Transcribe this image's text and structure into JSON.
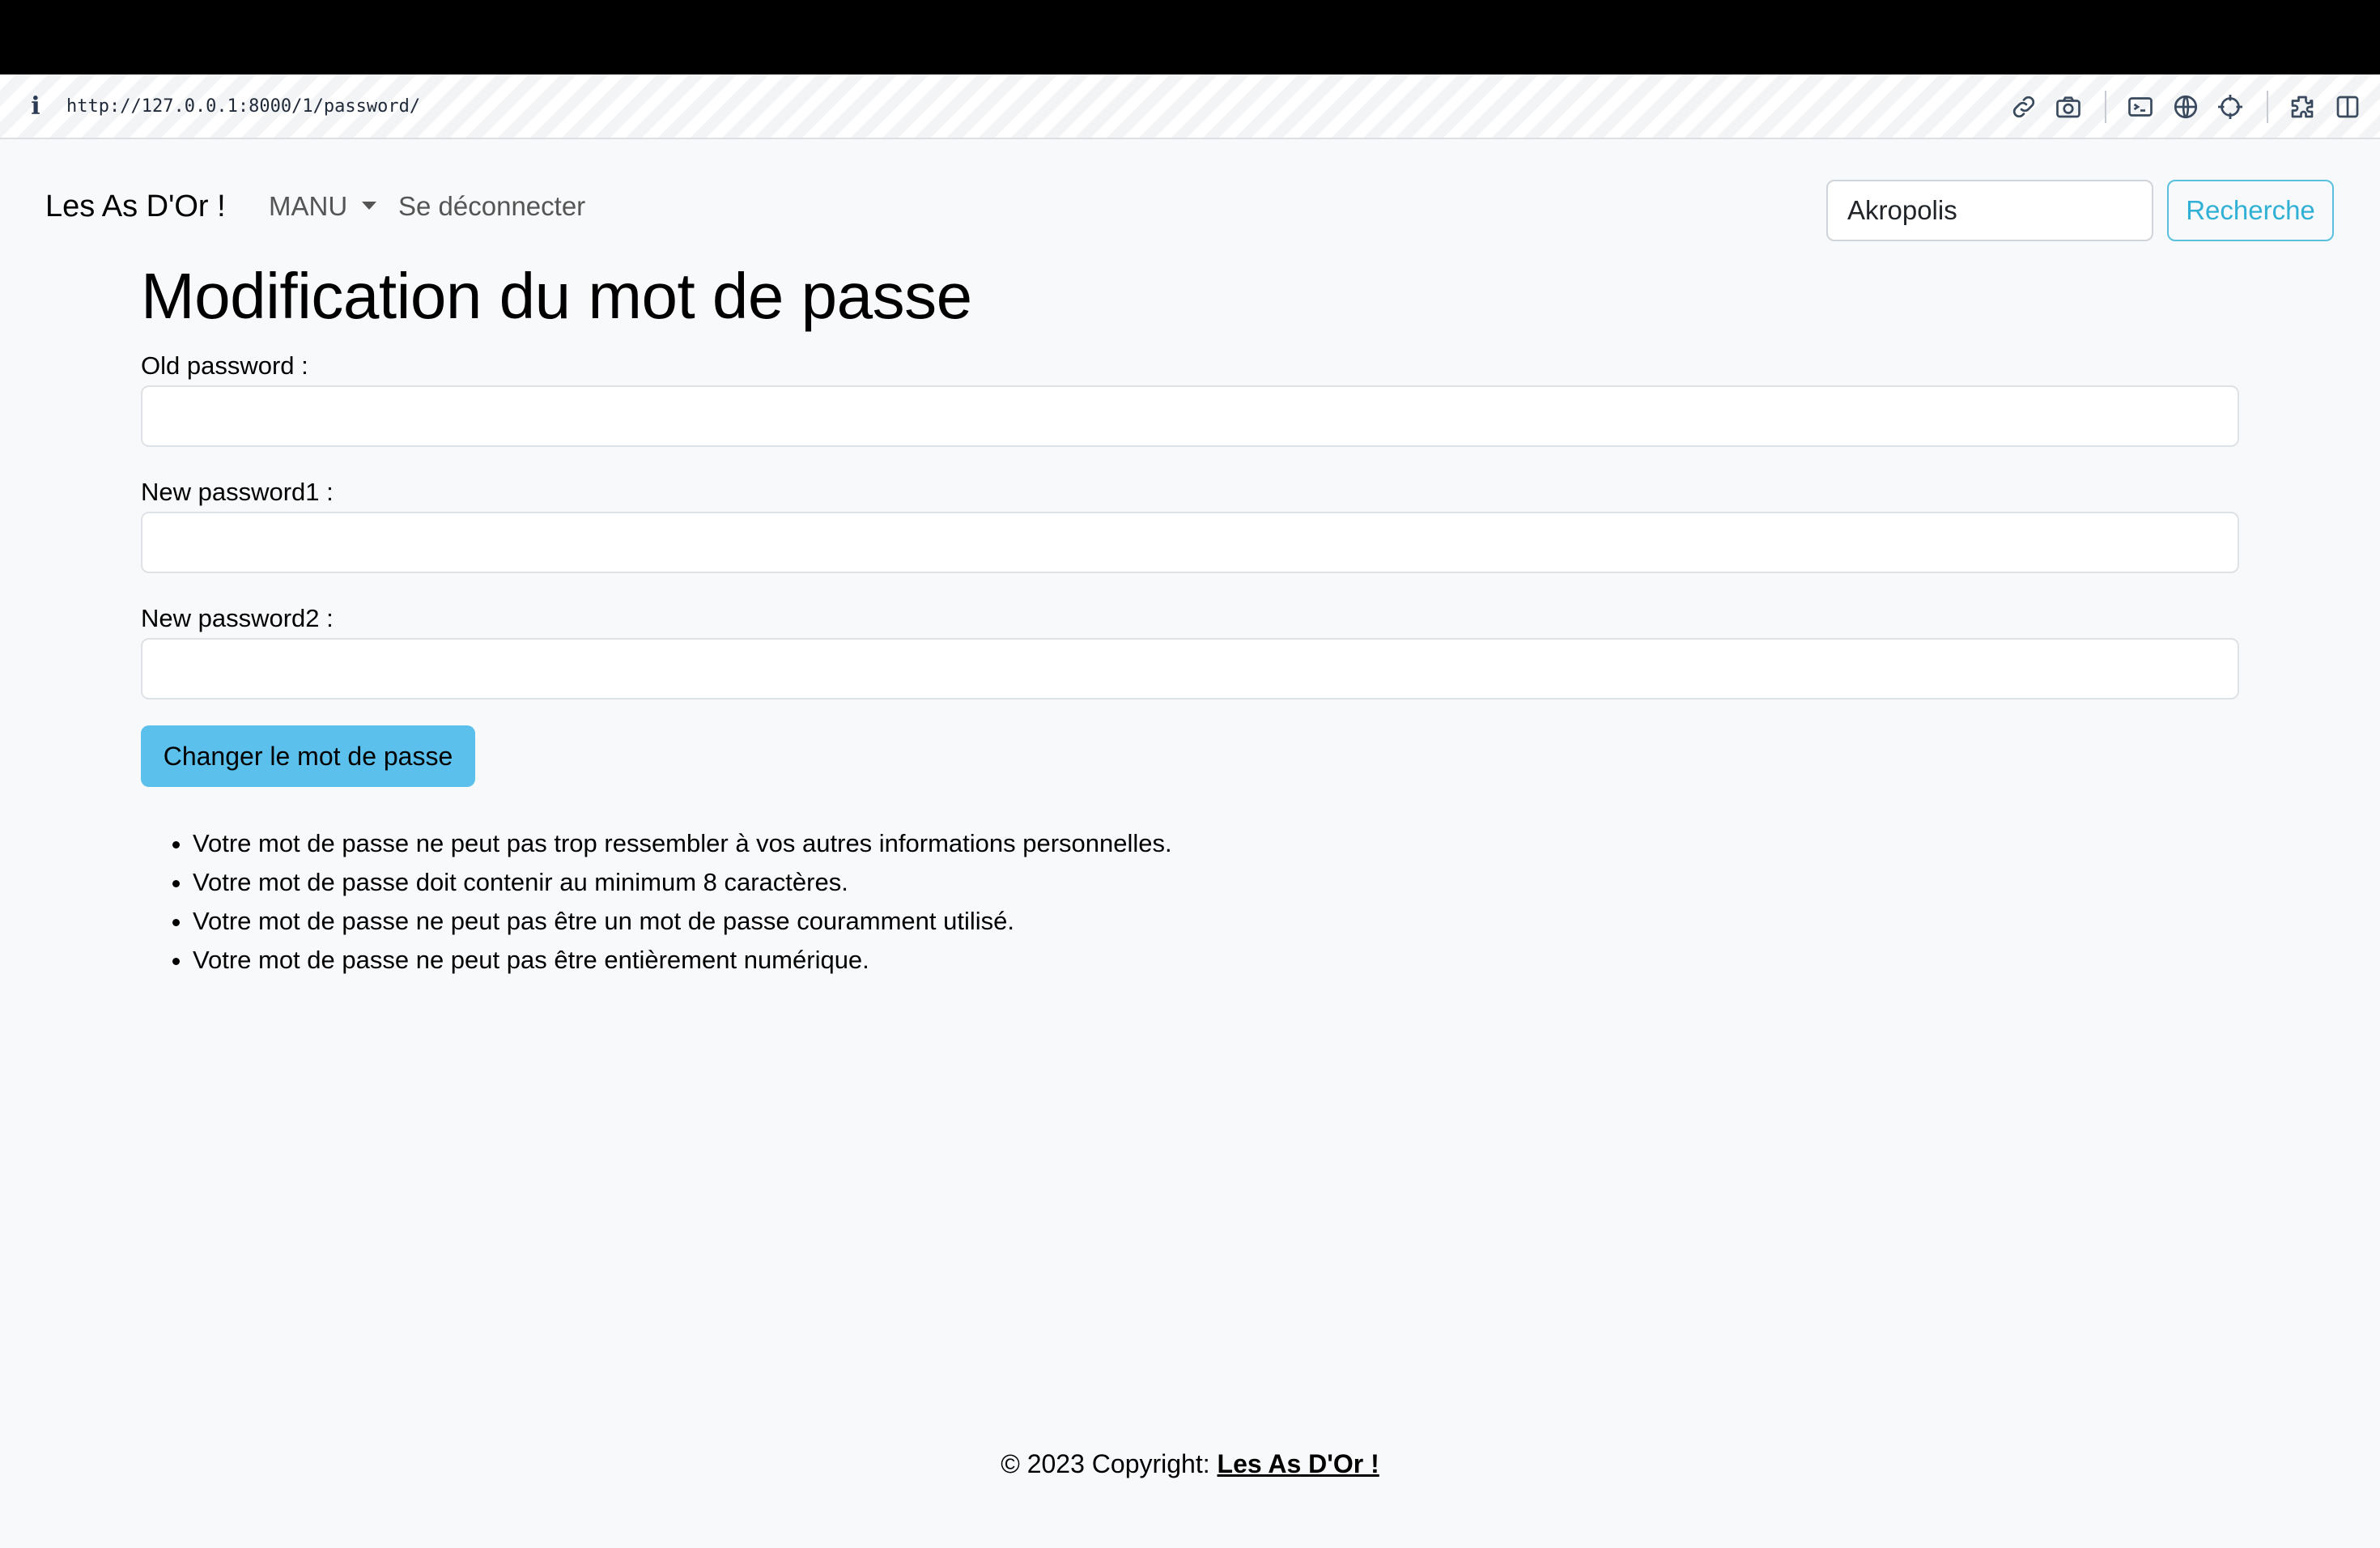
{
  "browser": {
    "info_icon": "i",
    "url": "http://127.0.0.1:8000/1/password/",
    "toolbar_icons": [
      "link-icon",
      "camera-icon",
      "terminal-icon",
      "globe-icon",
      "crosshair-icon",
      "extension-icon",
      "sidebar-icon"
    ]
  },
  "navbar": {
    "brand": "Les As D'Or !",
    "user_menu": "MANU",
    "logout": "Se déconnecter",
    "search_value": "Akropolis",
    "search_button": "Recherche"
  },
  "main": {
    "title": "Modification du mot de passe",
    "fields": [
      {
        "label": "Old password :",
        "value": ""
      },
      {
        "label": "New password1 :",
        "value": ""
      },
      {
        "label": "New password2 :",
        "value": ""
      }
    ],
    "submit_label": "Changer le mot de passe",
    "rules": [
      "Votre mot de passe ne peut pas trop ressembler à vos autres informations personnelles.",
      "Votre mot de passe doit contenir au minimum 8 caractères.",
      "Votre mot de passe ne peut pas être un mot de passe couramment utilisé.",
      "Votre mot de passe ne peut pas être entièrement numérique."
    ]
  },
  "footer": {
    "prefix": "© 2023 Copyright: ",
    "link": "Les As D'Or !"
  },
  "colors": {
    "page_background": "#f8f9fa",
    "accent": "#5bc0de",
    "submit_background": "#5bc0eb"
  }
}
